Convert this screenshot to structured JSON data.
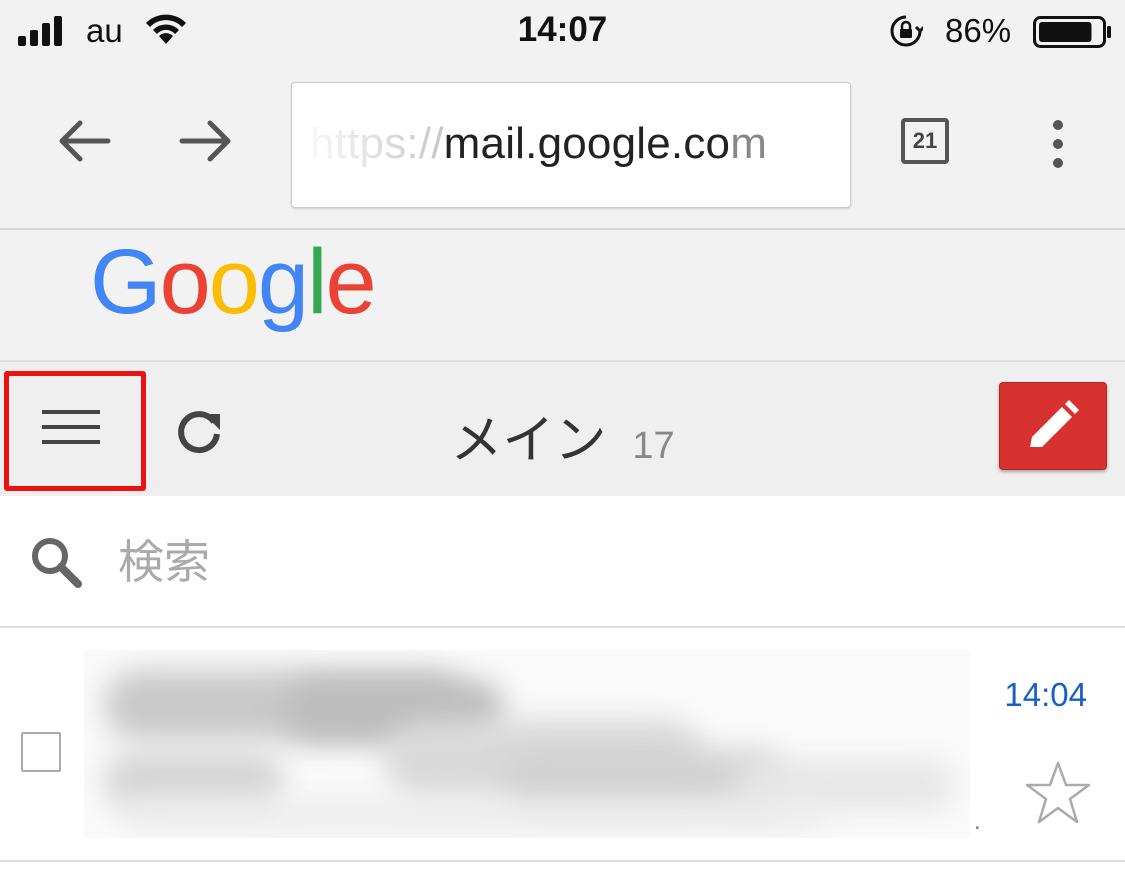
{
  "status_bar": {
    "carrier": "au",
    "time": "14:07",
    "battery_percent": "86%",
    "battery_level": 0.86,
    "icons": [
      "signal-icon",
      "wifi-icon",
      "rotation-lock-icon",
      "battery-icon"
    ]
  },
  "browser": {
    "url_faded": "https://",
    "url_host": "mail.google.co",
    "url_tail": "m",
    "tab_count": "21",
    "icons": [
      "back-arrow-icon",
      "forward-arrow-icon",
      "more-vert-icon"
    ]
  },
  "header": {
    "logo_letters": [
      {
        "char": "G",
        "color": "#4285F4"
      },
      {
        "char": "o",
        "color": "#EA4335"
      },
      {
        "char": "o",
        "color": "#FBBC05"
      },
      {
        "char": "g",
        "color": "#4285F4"
      },
      {
        "char": "l",
        "color": "#34A853"
      },
      {
        "char": "e",
        "color": "#EA4335"
      }
    ]
  },
  "toolbar": {
    "title": "メイン",
    "unread_count": "17",
    "highlight_color": "#EE1111",
    "compose_color": "#D7322F",
    "icons": [
      "hamburger-menu-icon",
      "refresh-icon",
      "pencil-icon"
    ]
  },
  "search": {
    "placeholder": "検索",
    "value": ""
  },
  "messages": [
    {
      "time": "14:04",
      "starred": false
    }
  ],
  "colors": {
    "time_link": "#1A5FC8",
    "background": "#F2F2F2"
  }
}
